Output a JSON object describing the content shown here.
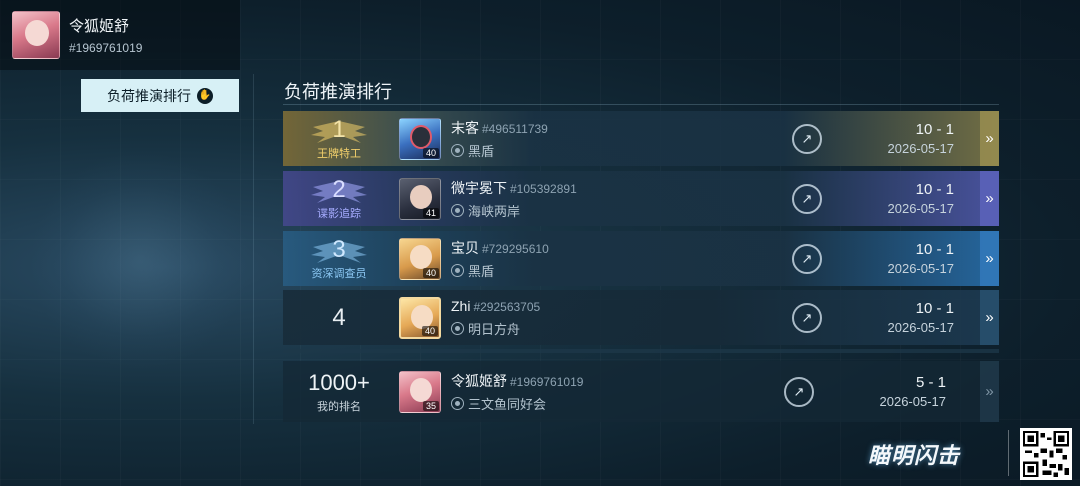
{
  "profile": {
    "name": "令狐姬舒",
    "id": "#1969761019"
  },
  "tab": {
    "label": "负荷推演排行",
    "icon": "hand-stop-icon"
  },
  "section": {
    "title": "负荷推演排行"
  },
  "rows": [
    {
      "rank": "1",
      "rank_title": "王牌特工",
      "name": "末客",
      "id": "#496511739",
      "level": "40",
      "guild": "黑盾",
      "score": "10 - 1",
      "date": "2026-05-17"
    },
    {
      "rank": "2",
      "rank_title": "谍影追踪",
      "name": "微宇冕下",
      "id": "#105392891",
      "level": "41",
      "guild": "海峡两岸",
      "score": "10 - 1",
      "date": "2026-05-17"
    },
    {
      "rank": "3",
      "rank_title": "资深调查员",
      "name": "宝贝",
      "id": "#729295610",
      "level": "40",
      "guild": "黑盾",
      "score": "10 - 1",
      "date": "2026-05-17"
    },
    {
      "rank": "4",
      "rank_title": "",
      "name": "Zhi",
      "id": "#292563705",
      "level": "40",
      "guild": "明日方舟",
      "score": "10 - 1",
      "date": "2026-05-17"
    }
  ],
  "my_rank": {
    "rank": "1000+",
    "label": "我的排名",
    "name": "令狐姬舒",
    "id": "#1969761019",
    "level": "35",
    "guild": "三文鱼同好会",
    "score": "5 - 1",
    "date": "2026-05-17"
  },
  "icons": {
    "trend": "trend-up-icon",
    "arrow": "double-chevron-right-icon",
    "guild": "guild-emblem-icon"
  },
  "logo": {
    "text": "瞄明闪击"
  },
  "colors": {
    "gold": "#f1cf6b",
    "purple": "#a6acff",
    "blue": "#8cc8f4",
    "tab_bg": "#d7f0f6"
  }
}
